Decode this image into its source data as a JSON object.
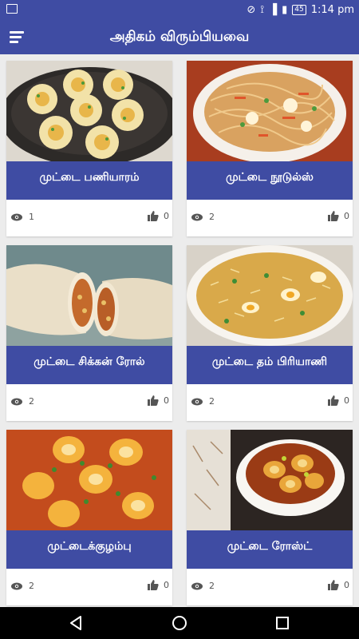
{
  "status_bar": {
    "time": "1:14 pm",
    "battery": "45"
  },
  "app_bar": {
    "title": "அதிகம் விரும்பியவை"
  },
  "recipes": [
    {
      "name": "முட்டை பணியாரம்",
      "views": "1",
      "likes": "0"
    },
    {
      "name": "முட்டை நூடுல்ஸ்",
      "views": "2",
      "likes": "0"
    },
    {
      "name": "முட்டை சிக்கன் ரோல்",
      "views": "2",
      "likes": "0"
    },
    {
      "name": "முட்டை தம் பிரியாணி",
      "views": "2",
      "likes": "0"
    },
    {
      "name": "முட்டைக்குழம்பு",
      "views": "2",
      "likes": "0"
    },
    {
      "name": "முட்டை ரோஸ்ட்",
      "views": "2",
      "likes": "0"
    }
  ],
  "colors": {
    "primary": "#3f4ca3",
    "background": "#ececec"
  }
}
